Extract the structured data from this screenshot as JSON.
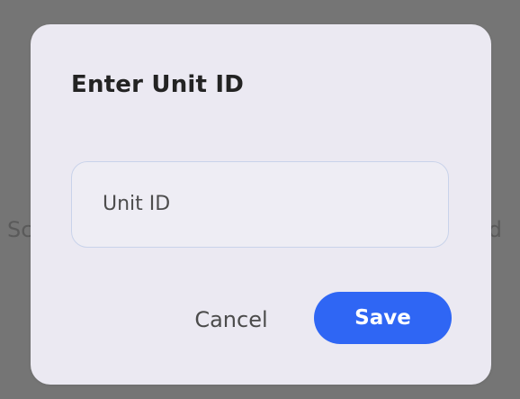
{
  "background": {
    "left_text": "Sc",
    "right_text": "ed"
  },
  "dialog": {
    "title": "Enter Unit ID",
    "input": {
      "placeholder": "Unit ID",
      "value": ""
    },
    "buttons": {
      "cancel_label": "Cancel",
      "save_label": "Save"
    }
  },
  "colors": {
    "overlay": "#757575",
    "dialog_background": "#ebe9f2",
    "input_border": "#c9d3ea",
    "primary": "#2f66f4",
    "title_text": "#232323"
  }
}
